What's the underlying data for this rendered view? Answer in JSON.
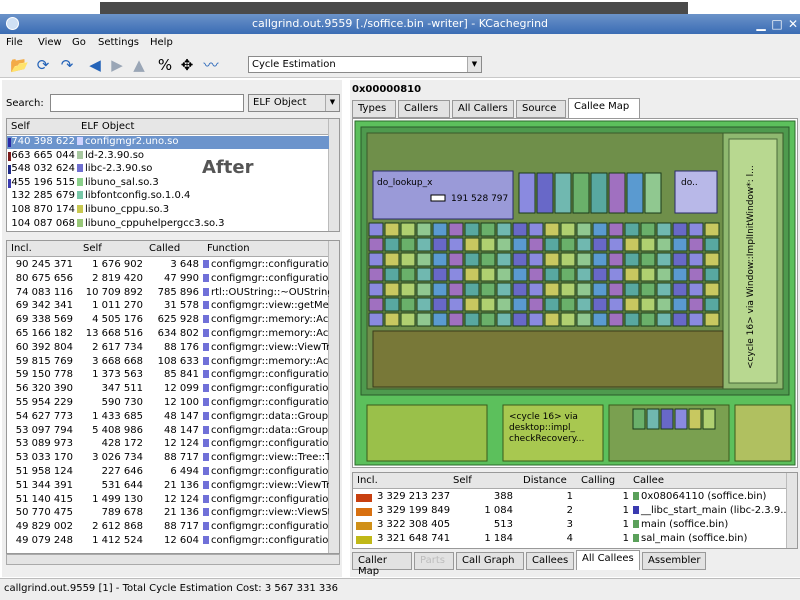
{
  "window": {
    "title": "callgrind.out.9559 [./soffice.bin -writer] - KCachegrind"
  },
  "menu": [
    "File",
    "View",
    "Go",
    "Settings",
    "Help"
  ],
  "toolbar": {
    "cost_type": "Cycle Estimation"
  },
  "search": {
    "label": "Search:",
    "group_by": "ELF Object"
  },
  "elf_list": {
    "headers": [
      "Self",
      "ELF Object"
    ],
    "rows": [
      {
        "self": "740 398 622",
        "name": "configmgr2.uno.so",
        "color": "#2a2aa8",
        "swatch": "#cfd3ff",
        "selected": true
      },
      {
        "self": "663 665 044",
        "name": "ld-2.3.90.so",
        "color": "#7a1a1a",
        "swatch": "#a8c8a0",
        "selected": false
      },
      {
        "self": "548 032 624",
        "name": "libc-2.3.90.so",
        "color": "#1f2a8a",
        "swatch": "#6f6fd0",
        "selected": false
      },
      {
        "self": "455 196 515",
        "name": "libuno_sal.so.3",
        "color": "#3a3ab0",
        "swatch": "#8ad08a",
        "selected": false
      },
      {
        "self": "132 285 679",
        "name": "libfontconfig.so.1.0.4",
        "color": "",
        "swatch": "#78c8a8",
        "selected": false
      },
      {
        "self": "108 870 174",
        "name": "libuno_cppu.so.3",
        "color": "",
        "swatch": "#c8c850",
        "selected": false
      },
      {
        "self": "104 087 068",
        "name": "libuno_cppuhelpergcc3.so.3",
        "color": "",
        "swatch": "#98c878",
        "selected": false
      }
    ],
    "overlay_label": "After"
  },
  "func_list": {
    "headers": [
      "Incl.",
      "Self",
      "Called",
      "Function"
    ],
    "rows": [
      [
        "90 245 371",
        "1 676 902",
        "3 648",
        "configmgr::configuration::"
      ],
      [
        "80 675 656",
        "2 819 420",
        "47 990",
        "configmgr::configuration::"
      ],
      [
        "74 083 116",
        "10 709 892",
        "785 896",
        "rtl::OUString::~OUString("
      ],
      [
        "69 342 341",
        "1 011 270",
        "31 578",
        "configmgr::view::getMem"
      ],
      [
        "69 338 569",
        "4 505 176",
        "625 928",
        "configmgr::memory::Acce"
      ],
      [
        "65 166 182",
        "13 668 516",
        "634 802",
        "configmgr::memory::Acce"
      ],
      [
        "60 392 804",
        "2 617 734",
        "88 176",
        "configmgr::view::ViewTre"
      ],
      [
        "59 815 769",
        "3 668 668",
        "108 633",
        "configmgr::memory::Acce"
      ],
      [
        "59 150 778",
        "1 373 563",
        "85 841",
        "configmgr::configuration::"
      ],
      [
        "56 320 390",
        "347 511",
        "12 099",
        "configmgr::configuration::"
      ],
      [
        "55 954 229",
        "590 730",
        "12 100",
        "configmgr::configuration::"
      ],
      [
        "54 627 773",
        "1 433 685",
        "48 147",
        "configmgr::data::GroupN"
      ],
      [
        "53 097 794",
        "5 408 986",
        "48 147",
        "configmgr::data::GroupN"
      ],
      [
        "53 089 973",
        "428 172",
        "12 124",
        "configmgr::configuration::"
      ],
      [
        "53 033 170",
        "3 026 734",
        "88 717",
        "configmgr::view::Tree::Tr"
      ],
      [
        "51 958 124",
        "227 646",
        "6 494",
        "configmgr::configuration::"
      ],
      [
        "51 344 391",
        "531 644",
        "21 136",
        "configmgr::view::ViewTre"
      ],
      [
        "51 140 415",
        "1 499 130",
        "12 124",
        "configmgr::configuration::"
      ],
      [
        "50 770 475",
        "789 678",
        "21 136",
        "configmgr::view::ViewStr"
      ],
      [
        "49 829 002",
        "2 612 868",
        "88 717",
        "configmgr::configuration::"
      ],
      [
        "49 079 248",
        "1 412 524",
        "12 604",
        "configmgr::configuration::"
      ]
    ]
  },
  "detail": {
    "address": "0x00000810",
    "tabs": [
      "Types",
      "Callers",
      "All Callers",
      "Source",
      "Callee Map"
    ],
    "active_tab": "Callee Map",
    "map": {
      "big_label": "do_lookup_x",
      "big_value": "191 528 797",
      "small_label": "do..",
      "vertical_label": "<cycle 16> via Window::ImplInitWindow*: l...",
      "bottom_label_lines": [
        "<cycle 16> via",
        "desktop::impl_",
        "checkRecovery..."
      ]
    },
    "callee_table": {
      "headers": [
        "Incl.",
        "Self",
        "Distance",
        "Calling",
        "Callee"
      ],
      "rows": [
        {
          "incl": "3 329 213 237",
          "self": "388",
          "distance": "1",
          "calling": "1",
          "callee": "0x08064110 (soffice.bin)",
          "color": "#c84010",
          "swatch": "#5aa05a"
        },
        {
          "incl": "3 329 199 849",
          "self": "1 084",
          "distance": "2",
          "calling": "1",
          "callee": "__libc_start_main (libc-2.3.9...",
          "color": "#d87010",
          "swatch": "#3a3ab0"
        },
        {
          "incl": "3 322 308 405",
          "self": "513",
          "distance": "3",
          "calling": "1",
          "callee": "main (soffice.bin)",
          "color": "#d09018",
          "swatch": "#5aa05a"
        },
        {
          "incl": "3 321 648 741",
          "self": "1 184",
          "distance": "4",
          "calling": "1",
          "callee": "sal_main (soffice.bin)",
          "color": "#c0b818",
          "swatch": "#5aa05a"
        }
      ]
    },
    "bottom_tabs": [
      "Caller Map",
      "Parts",
      "Call Graph",
      "Callees",
      "All Callees",
      "Assembler"
    ],
    "active_bottom_tab": "All Callees"
  },
  "status": "callgrind.out.9559 [1] - Total Cycle Estimation Cost: 3 567 331 336"
}
